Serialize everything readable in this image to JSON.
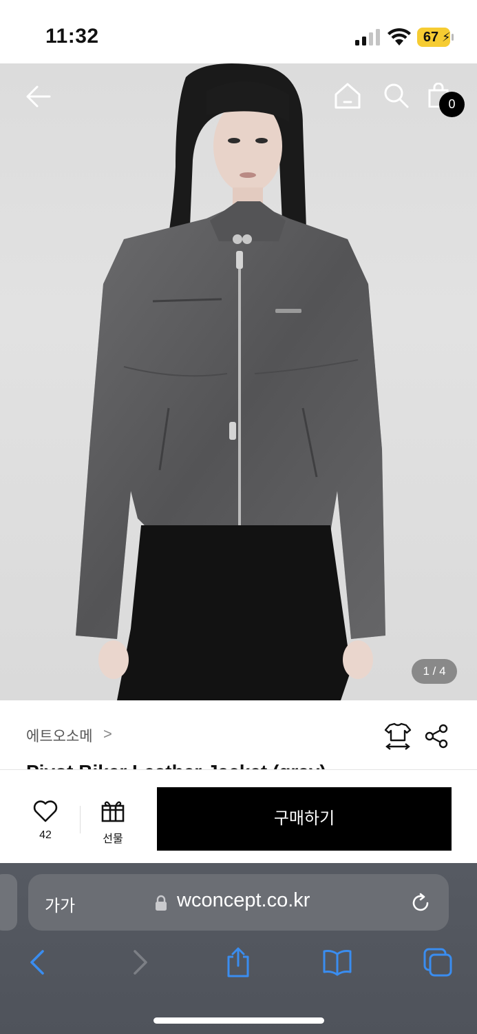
{
  "status_bar": {
    "time": "11:32",
    "battery": "67"
  },
  "colors": {
    "accent_link": "#3a8df0",
    "battery_yellow": "#f6cc32",
    "buy_button_bg": "#000000"
  },
  "header": {
    "back_icon": "arrow-left-icon",
    "home_icon": "home-icon",
    "search_icon": "search-icon",
    "cart_icon": "shopping-bag-icon",
    "cart_count": "0"
  },
  "gallery": {
    "page_indicator": "1 / 4"
  },
  "product": {
    "brand": "에트오소메",
    "brand_chevron": ">",
    "title_partial": "Pivot Biker Leather Jacket (gray)",
    "size_icon": "size-guide-icon",
    "share_icon": "share-icon"
  },
  "actions": {
    "like_count": "42",
    "gift_label": "선물",
    "buy_label": "구매하기"
  },
  "browser": {
    "text_size_label": "가가",
    "url": "wconcept.co.kr",
    "toolbar": [
      "back-icon",
      "forward-icon",
      "share-icon",
      "bookmarks-icon",
      "tabs-icon"
    ]
  }
}
